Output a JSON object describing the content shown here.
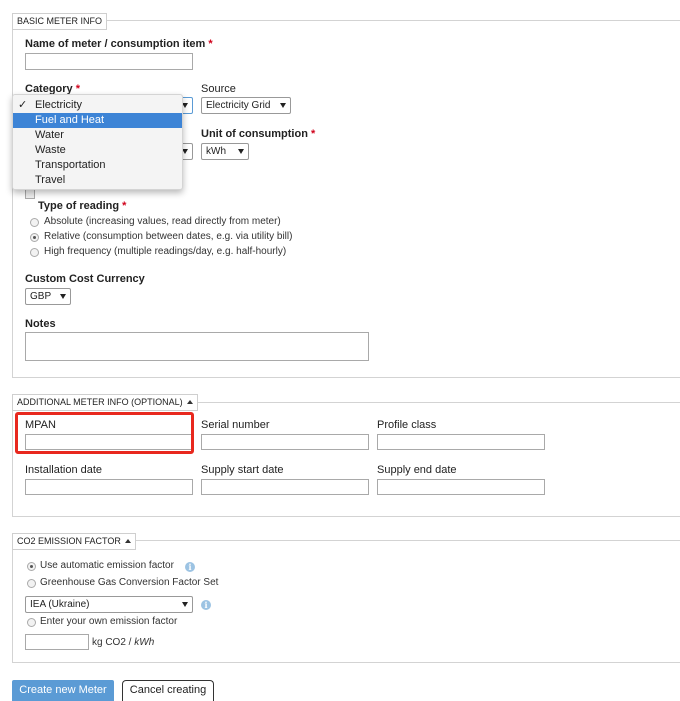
{
  "basic": {
    "legend": "BASIC METER INFO",
    "name_label": "Name of meter / consumption item",
    "req": "*",
    "category_label": "Category",
    "category_options": [
      {
        "label": "Electricity",
        "checked": "✓"
      },
      {
        "label": "Fuel and Heat"
      },
      {
        "label": "Water"
      },
      {
        "label": "Waste"
      },
      {
        "label": "Transportation"
      },
      {
        "label": "Travel"
      }
    ],
    "source_label": "Source",
    "source_value": "Electricity Grid",
    "unit_label": "Unit of consumption",
    "unit_value": "kWh",
    "reading_label": "Type of reading",
    "reading_options": [
      {
        "label": "Absolute (increasing values, read directly from meter)",
        "selected": false
      },
      {
        "label": "Relative (consumption between dates, e.g. via utility bill)",
        "selected": true
      },
      {
        "label": "High frequency (multiple readings/day, e.g. half-hourly)",
        "selected": false
      }
    ],
    "currency_label": "Custom Cost Currency",
    "currency_value": "GBP",
    "notes_label": "Notes"
  },
  "additional": {
    "legend": "ADDITIONAL METER INFO (OPTIONAL)",
    "mpan_label": "MPAN",
    "serial_label": "Serial number",
    "profile_label": "Profile class",
    "install_label": "Installation date",
    "supply_start_label": "Supply start date",
    "supply_end_label": "Supply end date",
    "highlight_color": "#e8281e"
  },
  "co2": {
    "legend": "CO2 EMISSION FACTOR",
    "auto_label": "Use automatic emission factor",
    "ghg_label": "Greenhouse Gas Conversion Factor Set",
    "factor_set_value": "IEA (Ukraine)",
    "own_label": "Enter your own emission factor",
    "unit_prefix": "kg CO2 / ",
    "unit_suffix": "kWh",
    "info_glyph": "i"
  },
  "actions": {
    "create_label": "Create new Meter",
    "cancel_label": "Cancel creating",
    "primary_color": "#5b9bd5"
  }
}
